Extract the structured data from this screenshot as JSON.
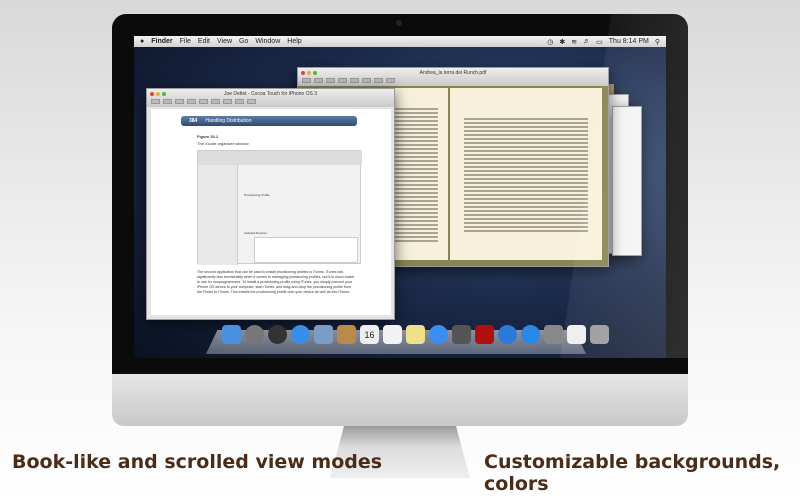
{
  "menubar": {
    "apple": "",
    "items": [
      "Finder",
      "File",
      "Edit",
      "View",
      "Go",
      "Window",
      "Help"
    ],
    "clock": "Thu 8:14 PM"
  },
  "book_window": {
    "title": "Andrea_la terra dei Runch.pdf"
  },
  "front_window": {
    "title": "Joe Detlet - Cocoa Touch for iPhone OS 3",
    "chapter_number": "384",
    "chapter_title": "Handling Distribution",
    "figure_label": "Figure 33.1",
    "figure_caption": "The Xcode organizer window",
    "profile_heading": "Provisioning Profile",
    "devices_heading": "Included Devices",
    "body_text": "The second application that can be used to install provisioning profiles is iTunes. iTunes has significantly less functionality when it comes to managing provisioning profiles, but it is much easier to use for nonprogrammers. To install a provisioning profile using iTunes, you simply connect your iPhone OS device to your computer, start iTunes, and drag-and-drop the provisioning profile from the Finder to iTunes. This installs the provisioning profile onto your device as well as into iTunes."
  },
  "dock": {
    "items": [
      {
        "icon": "finder",
        "color": "#4a8fe0"
      },
      {
        "icon": "launchpad",
        "color": "#777"
      },
      {
        "icon": "dashboard",
        "color": "#333"
      },
      {
        "icon": "safari",
        "color": "#3a8ee6"
      },
      {
        "icon": "mail",
        "color": "#7a9cc7"
      },
      {
        "icon": "address-book",
        "color": "#b98a4a"
      },
      {
        "icon": "calendar",
        "color": "#eee",
        "label": "16"
      },
      {
        "icon": "reminders",
        "color": "#f2f2f2"
      },
      {
        "icon": "notes",
        "color": "#f0e08a"
      },
      {
        "icon": "messages",
        "color": "#3b8ef0"
      },
      {
        "icon": "facetime",
        "color": "#555"
      },
      {
        "icon": "photo-booth",
        "color": "#b01010"
      },
      {
        "icon": "itunes",
        "color": "#2a7ad8"
      },
      {
        "icon": "app-store",
        "color": "#2a88e6"
      },
      {
        "icon": "system-preferences",
        "color": "#888"
      },
      {
        "icon": "document",
        "color": "#eee"
      },
      {
        "icon": "trash",
        "color": "#999"
      }
    ]
  },
  "captions": {
    "left": "Book-like and scrolled view modes",
    "right": "Customizable backgrounds, colors"
  }
}
